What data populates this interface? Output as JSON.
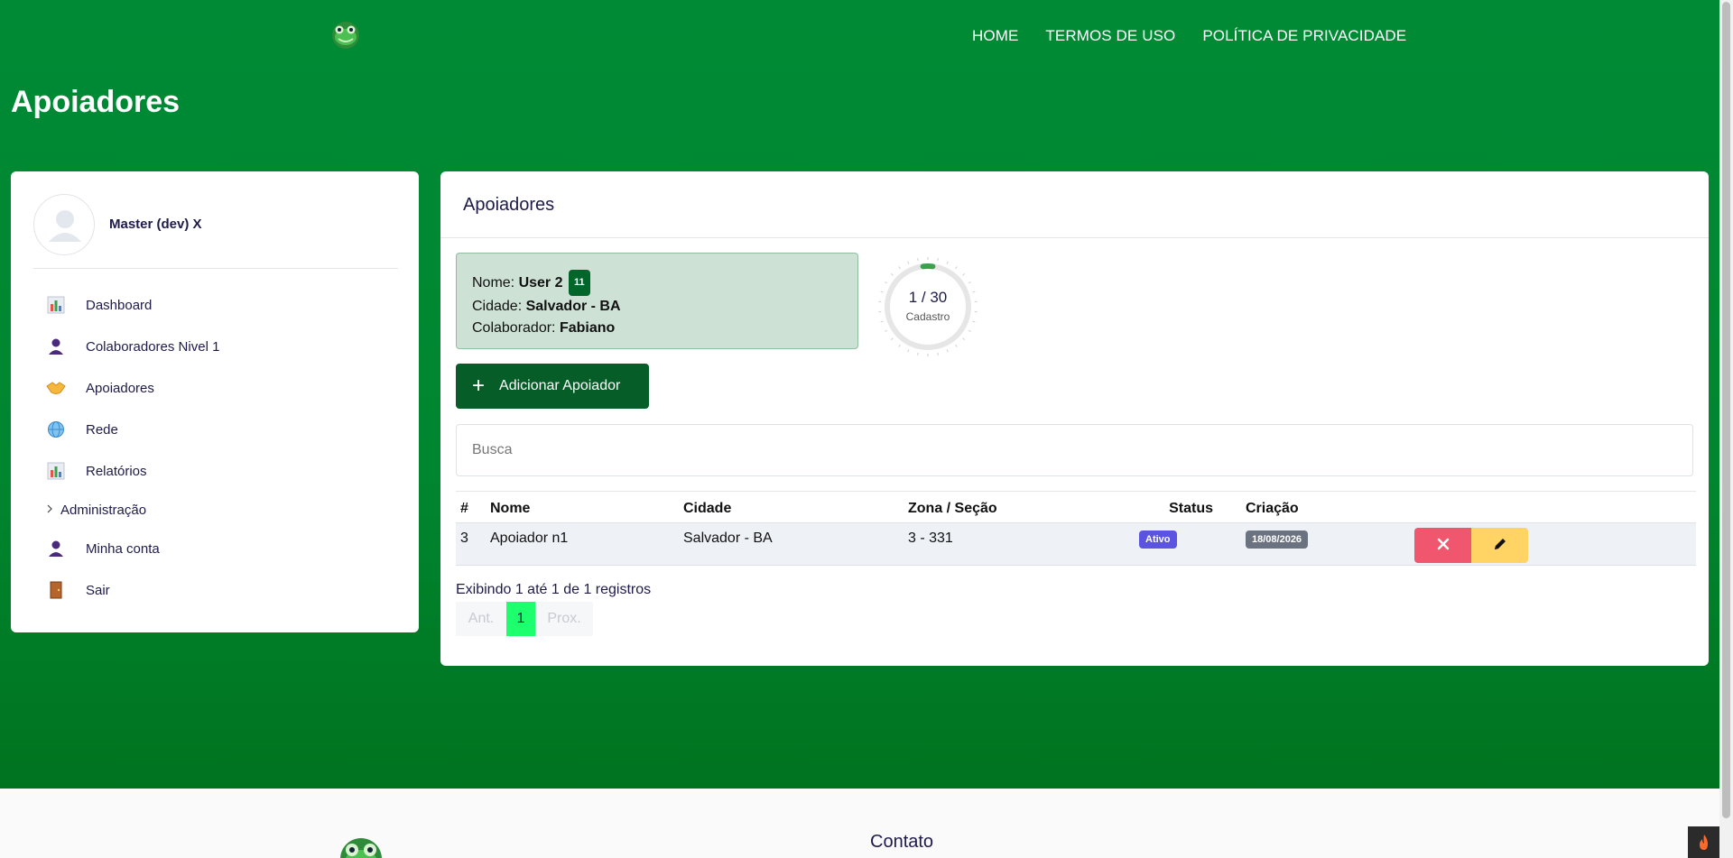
{
  "nav": {
    "links": [
      "HOME",
      "TERMOS DE USO",
      "POLÍTICA DE PRIVACIDADE"
    ]
  },
  "page": {
    "title": "Apoiadores"
  },
  "sidebar": {
    "user_name": "Master (dev) X",
    "items": [
      {
        "label": "Dashboard",
        "icon": "bar-chart-icon"
      },
      {
        "label": "Colaboradores Nivel 1",
        "icon": "user-icon"
      },
      {
        "label": "Apoiadores",
        "icon": "handshake-icon"
      },
      {
        "label": "Rede",
        "icon": "globe-icon"
      },
      {
        "label": "Relatórios",
        "icon": "bar-chart-icon"
      },
      {
        "label": "Administração",
        "icon": "chevron-right-icon"
      },
      {
        "label": "Minha conta",
        "icon": "user-icon"
      },
      {
        "label": "Sair",
        "icon": "door-icon"
      }
    ]
  },
  "card": {
    "title": "Apoiadores",
    "info": {
      "nome_label": "Nome:",
      "nome_value": "User 2",
      "nome_badge": "11",
      "cidade_label": "Cidade:",
      "cidade_value": "Salvador - BA",
      "colaborador_label": "Colaborador:",
      "colaborador_value": "Fabiano"
    },
    "gauge": {
      "value_text": "1 / 30",
      "label": "Cadastro",
      "current": 1,
      "max": 30
    },
    "add_button": "Adicionar Apoiador",
    "search_placeholder": "Busca",
    "table": {
      "headers": [
        "#",
        "Nome",
        "Cidade",
        "Zona / Seção",
        "Status",
        "Criação"
      ],
      "rows": [
        {
          "id": "3",
          "nome": "Apoiador n1",
          "cidade": "Salvador - BA",
          "zona": "3 - 331",
          "status": "Ativo",
          "criacao": "18/08/2026"
        }
      ]
    },
    "summary": "Exibindo 1 até 1 de 1 registros",
    "pager": {
      "prev": "Ant.",
      "current": "1",
      "next": "Prox."
    }
  },
  "footer": {
    "contact": "Contato"
  },
  "colors": {
    "brand_green": "#008a35",
    "button_green": "#075d27",
    "active_page": "#1dff6d",
    "delete": "#f0566e",
    "edit": "#ffd465",
    "status_active": "#5b54e0"
  }
}
